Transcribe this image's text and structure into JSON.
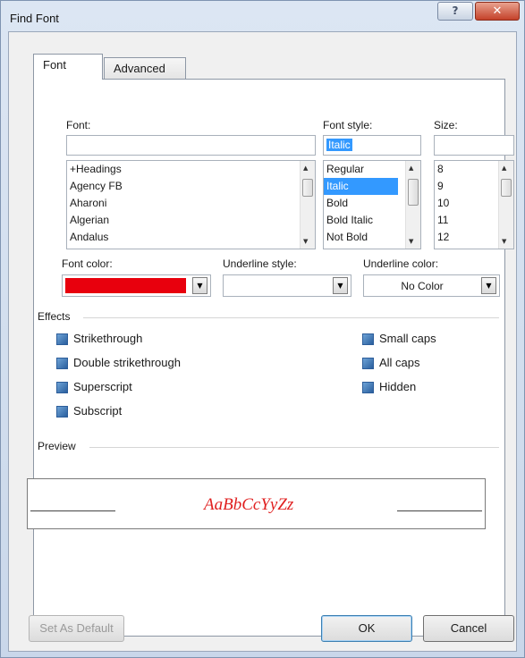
{
  "window": {
    "title": "Find Font",
    "help_glyph": "?",
    "close_glyph": "✕"
  },
  "tabs": [
    {
      "label": "Font",
      "active": true
    },
    {
      "label": "Advanced",
      "active": false
    }
  ],
  "font": {
    "label": "Font:",
    "value": "",
    "items": [
      "+Headings",
      "Agency FB",
      "Aharoni",
      "Algerian",
      "Andalus"
    ]
  },
  "style": {
    "label": "Font style:",
    "value": "Italic",
    "items": [
      "Regular",
      "Italic",
      "Bold",
      "Bold Italic",
      "Not Bold"
    ],
    "selected": "Italic"
  },
  "size": {
    "label": "Size:",
    "value": "",
    "items": [
      "8",
      "9",
      "10",
      "11",
      "12"
    ]
  },
  "font_color": {
    "label": "Font color:",
    "swatch": "#e8000d"
  },
  "underline_style": {
    "label": "Underline style:",
    "value": ""
  },
  "underline_color": {
    "label": "Underline color:",
    "value": "No Color"
  },
  "effects": {
    "label": "Effects",
    "left": [
      "Strikethrough",
      "Double strikethrough",
      "Superscript",
      "Subscript"
    ],
    "right": [
      "Small caps",
      "All caps",
      "Hidden"
    ]
  },
  "preview": {
    "label": "Preview",
    "sample": "AaBbCcYyZz",
    "color": "#e02020"
  },
  "buttons": {
    "set_default": "Set As Default",
    "ok": "OK",
    "cancel": "Cancel"
  }
}
